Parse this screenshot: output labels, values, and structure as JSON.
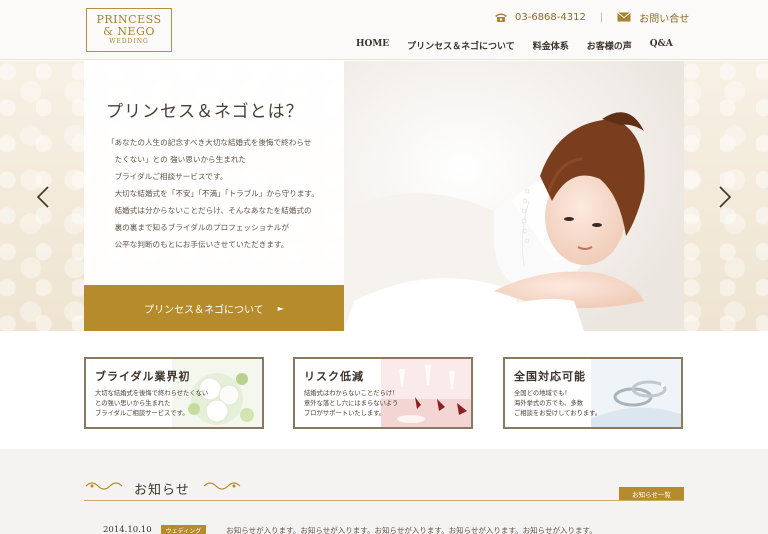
{
  "header": {
    "logo": {
      "line1": "PRINCESS",
      "line2": "& NEGO",
      "line3": "WEDDING"
    },
    "phone": "03-6868-4312",
    "separator": "|",
    "contact_label": "お問い合せ",
    "nav": [
      "HOME",
      "プリンセス＆ネゴについて",
      "料金体系",
      "お客様の声",
      "Q&A"
    ]
  },
  "hero": {
    "title": "プリンセス＆ネゴとは？",
    "body": [
      "「あなたの人生の記念すべき大切な結婚式を後悔で終わらせ",
      "　たくない」との 強い思いから生まれた",
      "　ブライダルご相談サービスです。",
      "　大切な結婚式を「不安」「不満」「トラブル」から守ります。",
      "　結婚式は分からないことだらけ、そんなあなたを結婚式の",
      "　裏の裏まで知るブライダルのプロフェッショナルが",
      "　公平な判断のもとにお手伝いさせていただきます。"
    ],
    "button_label": "プリンセス＆ネゴについて",
    "button_arrow": "►",
    "prev_icon": "chevron-left-icon",
    "next_icon": "chevron-right-icon"
  },
  "features": [
    {
      "title": "ブライダル業界初",
      "lines": [
        "大切な結婚式を後悔で終わらせたくない",
        "との強い思いから生まれた",
        "ブライダルご相談サービスです。"
      ]
    },
    {
      "title": "リスク低減",
      "lines": [
        "結婚式はわからないことだらけ！",
        "意外な落とし穴にはまらないよう",
        "プロがサポートいたします。"
      ]
    },
    {
      "title": "全国対応可能",
      "lines": [
        "全国どの地域でも！",
        "海外挙式の方でも、多数",
        "ご相談をお受けしております。"
      ]
    }
  ],
  "news": {
    "title": "お知らせ",
    "all_label": "お知らせ一覧",
    "items": [
      {
        "date": "2014.10.10",
        "category": "ウェディング",
        "text": "お知らせが入ります。お知らせが入ります。お知らせが入ります。お知らせが入ります。お知らせが入ります。"
      }
    ]
  },
  "colors": {
    "accent_gold": "#b58b2b",
    "logo_gold": "#a8822f",
    "text_dark": "#3c342c"
  }
}
